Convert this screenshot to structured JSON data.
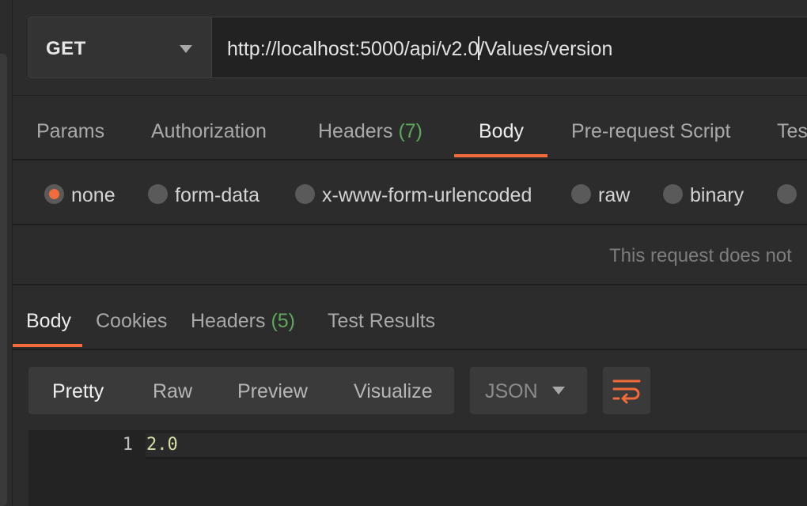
{
  "request": {
    "method": "GET",
    "url_before_caret": "http://localhost:5000/api/v2.0",
    "url_after_caret": "/Values/version"
  },
  "request_tabs": [
    {
      "label": "Params"
    },
    {
      "label": "Authorization"
    },
    {
      "label": "Headers",
      "count": "(7)"
    },
    {
      "label": "Body",
      "active": true
    },
    {
      "label": "Pre-request Script"
    },
    {
      "label": "Tes"
    }
  ],
  "body_types": [
    {
      "label": "none",
      "selected": true
    },
    {
      "label": "form-data"
    },
    {
      "label": "x-www-form-urlencoded"
    },
    {
      "label": "raw"
    },
    {
      "label": "binary"
    }
  ],
  "body_message": "This request does not",
  "response_tabs": [
    {
      "label": "Body",
      "active": true
    },
    {
      "label": "Cookies"
    },
    {
      "label": "Headers",
      "count": "(5)"
    },
    {
      "label": "Test Results"
    }
  ],
  "response_view_modes": [
    "Pretty",
    "Raw",
    "Preview",
    "Visualize"
  ],
  "response_view_active": "Pretty",
  "response_format": "JSON",
  "response_lines": [
    {
      "number": "1",
      "text": "2.0"
    }
  ],
  "colors": {
    "accent": "#f26b3a",
    "count_green": "#5fa85a",
    "background": "#2c2c2c",
    "code_value": "#d6dca2"
  },
  "icons": {
    "method_dropdown": "chevron-down-icon",
    "format_dropdown": "chevron-down-icon",
    "wrap": "wrap-lines-icon"
  }
}
